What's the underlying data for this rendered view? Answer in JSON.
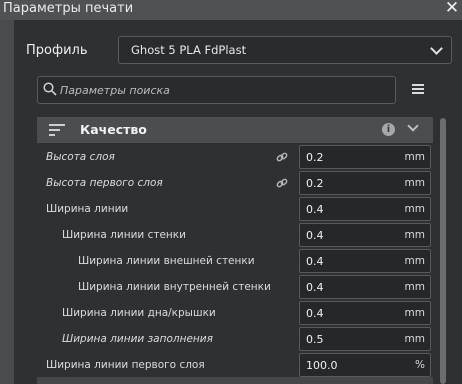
{
  "window": {
    "title": "Параметры печати",
    "close_label": "✕"
  },
  "profile": {
    "label": "Профиль",
    "selected": "Ghost 5 PLA FdPlast"
  },
  "search": {
    "placeholder": "Параметры поиска"
  },
  "category": {
    "title": "Качество",
    "info_label": "i"
  },
  "settings": [
    {
      "label": "Высота слоя",
      "value": "0.2",
      "unit": "mm",
      "italic": true,
      "linked": true
    },
    {
      "label": "Высота первого слоя",
      "value": "0.2",
      "unit": "mm",
      "italic": true,
      "linked": true
    },
    {
      "label": "Ширина линии",
      "value": "0.4",
      "unit": "mm",
      "italic": false,
      "linked": false
    },
    {
      "label": "Ширина линии стенки",
      "value": "0.4",
      "unit": "mm",
      "italic": false,
      "linked": false
    },
    {
      "label": "Ширина линии внешней стенки",
      "value": "0.4",
      "unit": "mm",
      "italic": false,
      "linked": false
    },
    {
      "label": "Ширина линии внутренней стенки",
      "value": "0.4",
      "unit": "mm",
      "italic": false,
      "linked": false
    },
    {
      "label": "Ширина линии дна/крышки",
      "value": "0.4",
      "unit": "mm",
      "italic": false,
      "linked": false
    },
    {
      "label": "Ширина линии заполнения",
      "value": "0.5",
      "unit": "mm",
      "italic": true,
      "linked": false
    },
    {
      "label": "Ширина линии первого слоя",
      "value": "100.0",
      "unit": "%",
      "italic": false,
      "linked": false
    }
  ],
  "colors": {
    "panel": "#2f3033",
    "header": "#4c4d51",
    "field": "#262729",
    "accent_text": "#f0f0f0"
  }
}
